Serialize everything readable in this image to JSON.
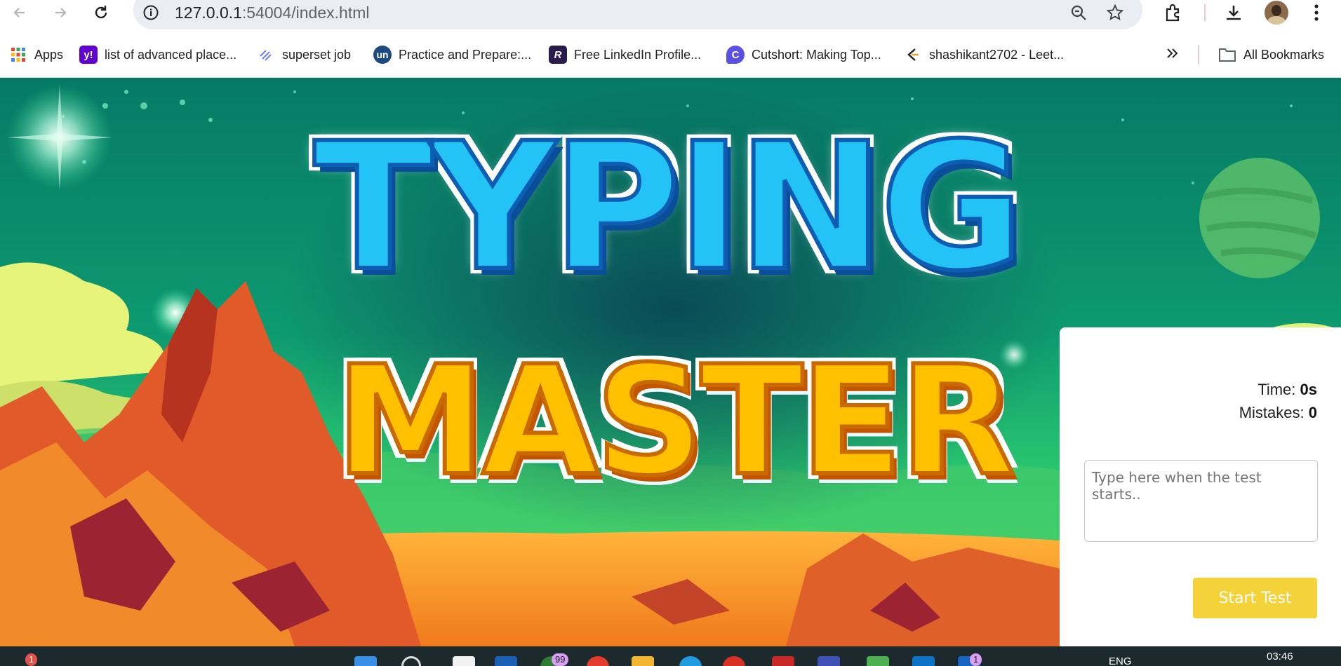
{
  "browser": {
    "url_host": "127.0.0.1",
    "url_rest": ":54004/index.html",
    "bookmarks": [
      {
        "label": "Apps",
        "icon": "apps-grid-icon"
      },
      {
        "label": "list of advanced place...",
        "icon": "yahoo-icon",
        "color": "#6001d2"
      },
      {
        "label": "superset job",
        "icon": "superset-icon",
        "color": "#6b7cff"
      },
      {
        "label": "Practice and Prepare:...",
        "icon": "unstop-icon",
        "color": "#1c4980"
      },
      {
        "label": "Free LinkedIn Profile...",
        "icon": "resume-icon",
        "color": "#2a1b4d"
      },
      {
        "label": "Cutshort: Making Top...",
        "icon": "cutshort-icon",
        "color": "#5b4fe6"
      },
      {
        "label": "shashikant2702 - Leet...",
        "icon": "leetcode-icon",
        "color": "#f89f1b"
      }
    ],
    "all_bookmarks": "All Bookmarks"
  },
  "hero": {
    "title_line1": "TYPING",
    "title_line2": "MASTER"
  },
  "panel": {
    "time_label": "Time:",
    "time_value": "0s",
    "mistakes_label": "Mistakes:",
    "mistakes_value": "0",
    "input_placeholder": "Type here when the test starts..",
    "start_button": "Start Test",
    "accent": "#f4d33a"
  },
  "taskbar": {
    "notification_badge": "1",
    "badge_99": "99",
    "badge_1": "1",
    "language": "ENG",
    "clock": "03:46"
  }
}
